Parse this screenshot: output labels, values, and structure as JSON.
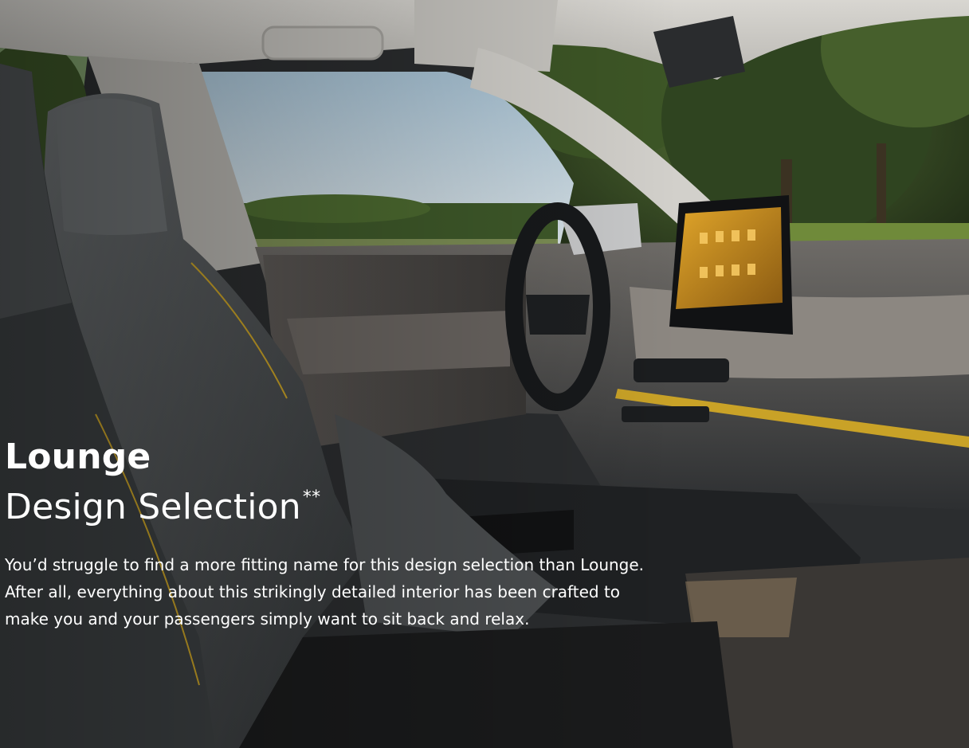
{
  "hero": {
    "title_bold": "Lounge",
    "title_light": "Design Selection",
    "title_note": "**",
    "description": "You’d struggle to find a more fitting name for this design selection than Lounge. After all, everything about this strikingly detailed interior has been crafted to make you and your passengers simply want to sit back and relax.",
    "image_alt": "Car interior with grey lounge seats, steering wheel, and infotainment touchscreen"
  },
  "colors": {
    "accent_trim": "#c9a227",
    "text": "#ffffff",
    "seat_grey": "#5b5f61",
    "dash_dark": "#22262a"
  }
}
